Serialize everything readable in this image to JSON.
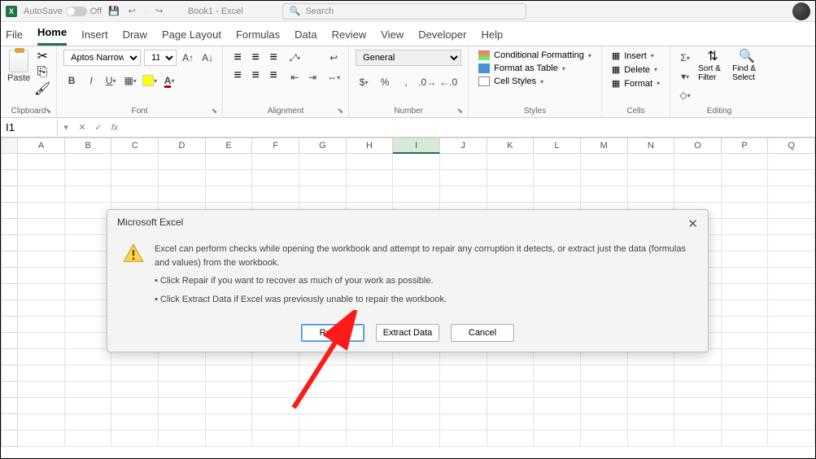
{
  "titlebar": {
    "autosave_label": "AutoSave",
    "autosave_state": "Off",
    "doc_title": "Book1 - Excel",
    "search_placeholder": "Search"
  },
  "tabs": [
    "File",
    "Home",
    "Insert",
    "Draw",
    "Page Layout",
    "Formulas",
    "Data",
    "Review",
    "View",
    "Developer",
    "Help"
  ],
  "active_tab": "Home",
  "ribbon": {
    "clipboard": {
      "paste": "Paste",
      "label": "Clipboard"
    },
    "font": {
      "name": "Aptos Narrow",
      "size": "11",
      "label": "Font"
    },
    "alignment": {
      "label": "Alignment"
    },
    "number": {
      "format": "General",
      "label": "Number"
    },
    "styles": {
      "cond": "Conditional Formatting",
      "table": "Format as Table",
      "cell": "Cell Styles",
      "label": "Styles"
    },
    "cells": {
      "insert": "Insert",
      "delete": "Delete",
      "format": "Format",
      "label": "Cells"
    },
    "editing": {
      "sort": "Sort & Filter",
      "find": "Find & Select",
      "label": "Editing"
    }
  },
  "formula_bar": {
    "cell_ref": "I1",
    "fx": "fx"
  },
  "columns": [
    "A",
    "B",
    "C",
    "D",
    "E",
    "F",
    "G",
    "H",
    "I",
    "J",
    "K",
    "L",
    "M",
    "N",
    "O",
    "P",
    "Q"
  ],
  "selected_col": "I",
  "dialog": {
    "title": "Microsoft Excel",
    "line1": "Excel can perform checks while opening the workbook and attempt to repair any corruption it detects, or extract just the data (formulas and values) from the workbook.",
    "bullet1": "• Click Repair if you want to recover as much of your work as possible.",
    "bullet2": "• Click Extract Data if Excel was previously unable to repair the workbook.",
    "btn_repair": "Repair",
    "btn_extract": "Extract Data",
    "btn_cancel": "Cancel"
  }
}
